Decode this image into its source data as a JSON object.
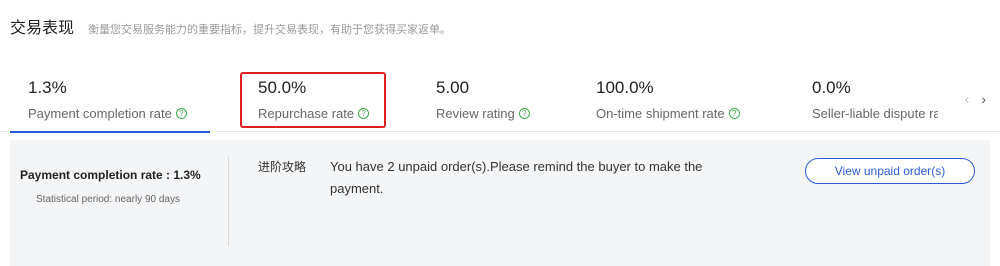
{
  "header": {
    "title": "交易表现",
    "subtitle": "衡量您交易服务能力的重要指标，提升交易表现，有助于您获得买家返单。"
  },
  "metrics": [
    {
      "value": "1.3%",
      "label": "Payment completion rate"
    },
    {
      "value": "50.0%",
      "label": "Repurchase rate"
    },
    {
      "value": "5.00",
      "label": "Review rating"
    },
    {
      "value": "100.0%",
      "label": "On-time shipment rate"
    },
    {
      "value": "0.0%",
      "label": "Seller-liable dispute rate"
    }
  ],
  "icons": {
    "help": "?",
    "prev": "‹",
    "next": "›"
  },
  "detail": {
    "rate_label": "Payment completion rate : 1.3%",
    "period": "Statistical period: nearly 90 days",
    "tips_label": "进阶攻略",
    "tips_text": "You have 2 unpaid order(s).Please remind the buyer to make the payment.",
    "button": "View unpaid order(s)"
  },
  "colors": {
    "accent": "#2a5bd7",
    "help_icon": "#3dad4a",
    "highlight": "#e02020"
  }
}
